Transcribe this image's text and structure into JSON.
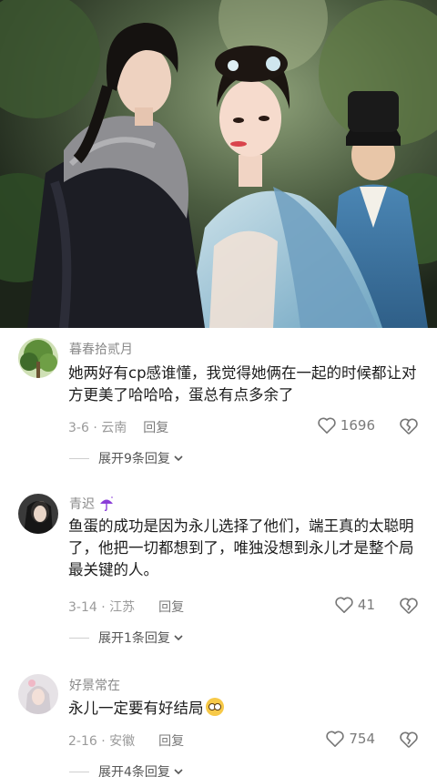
{
  "comments": [
    {
      "author": "暮春拾贰月",
      "text": "她两好有cp感谁懂，我觉得她俩在一起的时候都让对方更美了哈哈哈，蛋总有点多余了",
      "date": "3-6 · 云南",
      "reply_label": "回复",
      "likes": "1696",
      "expand_label": "展开9条回复",
      "avatar_color": "#4f7a3c"
    },
    {
      "author": "青迟",
      "author_badge": "umbrella-icon",
      "text": "鱼蛋的成功是因为永儿选择了他们，端王真的太聪明了，他把一切都想到了，唯独没想到永儿才是整个局最关键的人。",
      "date": "3-14 · 江苏",
      "reply_label": "回复",
      "likes": "41",
      "expand_label": "展开1条回复",
      "avatar_color": "#2a2a2a"
    },
    {
      "author": "好景常在",
      "text": "永儿一定要有好结局",
      "text_emoji": "pleading-face-icon",
      "date": "2-16 · 安徽",
      "reply_label": "回复",
      "likes": "754",
      "expand_label": "展开4条回复",
      "avatar_color": "#d9d4d8"
    }
  ],
  "colors": {
    "badge_purple": "#8a3dd8",
    "secondary_text": "#8a8a8a"
  }
}
